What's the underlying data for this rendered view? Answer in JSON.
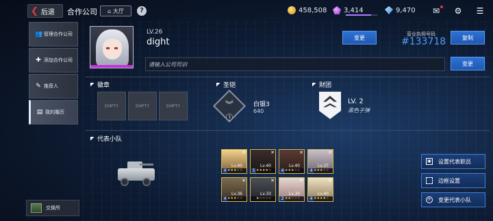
{
  "topbar": {
    "back_label": "后退",
    "page_title": "合作公司",
    "lobby_label": "大厅",
    "help": "?",
    "gold": "458,508",
    "gem": "3,414",
    "gem_progress": 0.8,
    "diamond": "9,470"
  },
  "sidebar": {
    "items": [
      {
        "label": "管理合作公司",
        "icon": "users-icon"
      },
      {
        "label": "添加合作公司",
        "icon": "add-user-icon"
      },
      {
        "label": "推荐人",
        "icon": "recommend-icon"
      },
      {
        "label": "我的履历",
        "icon": "resume-icon"
      }
    ],
    "swap_label": "交换所"
  },
  "profile": {
    "level": "LV.26",
    "username": "dight",
    "change_label": "变更",
    "license_label": "营业执照号码",
    "license_number": "#133718",
    "copy_label": "复制",
    "motto_placeholder": "请输入公司司训",
    "motto_change_label": "变更"
  },
  "sections": {
    "emblem_title": "徽章",
    "empty_label": "EMPTY",
    "armor_title": "圣铠",
    "rank_name": "白银3",
    "rank_points": "640",
    "rank_level": "3",
    "group_title": "财团",
    "group_level": "LV. 2",
    "group_name": "黑色子弹",
    "squad_title": "代表小队"
  },
  "squad": {
    "members": [
      {
        "lv": "Lv.40",
        "num": "4",
        "stars": "★★★☆☆"
      },
      {
        "lv": "Lv.40",
        "num": "5",
        "stars": "★★★★☆"
      },
      {
        "lv": "Lv.40",
        "num": "4",
        "stars": "★★★☆☆"
      },
      {
        "lv": "Lv.37",
        "num": "4",
        "stars": "★★★☆☆"
      },
      {
        "lv": "Lv.36",
        "num": "4",
        "stars": "★★★☆☆"
      },
      {
        "lv": "Lv.33",
        "num": "",
        "stars": "★☆☆☆☆"
      },
      {
        "lv": "Lv.30",
        "num": "2",
        "stars": "★★☆☆☆"
      },
      {
        "lv": "Lv.40",
        "num": "4",
        "stars": "★★★★☆"
      }
    ]
  },
  "actions": {
    "set_rep": "设置代表职员",
    "frame_set": "边框设置",
    "change_squad": "变更代表小队"
  },
  "colors": {
    "accent_blue": "#4fa0ff",
    "back_red": "#e23b3b",
    "card_gold": "#d9b54a"
  }
}
